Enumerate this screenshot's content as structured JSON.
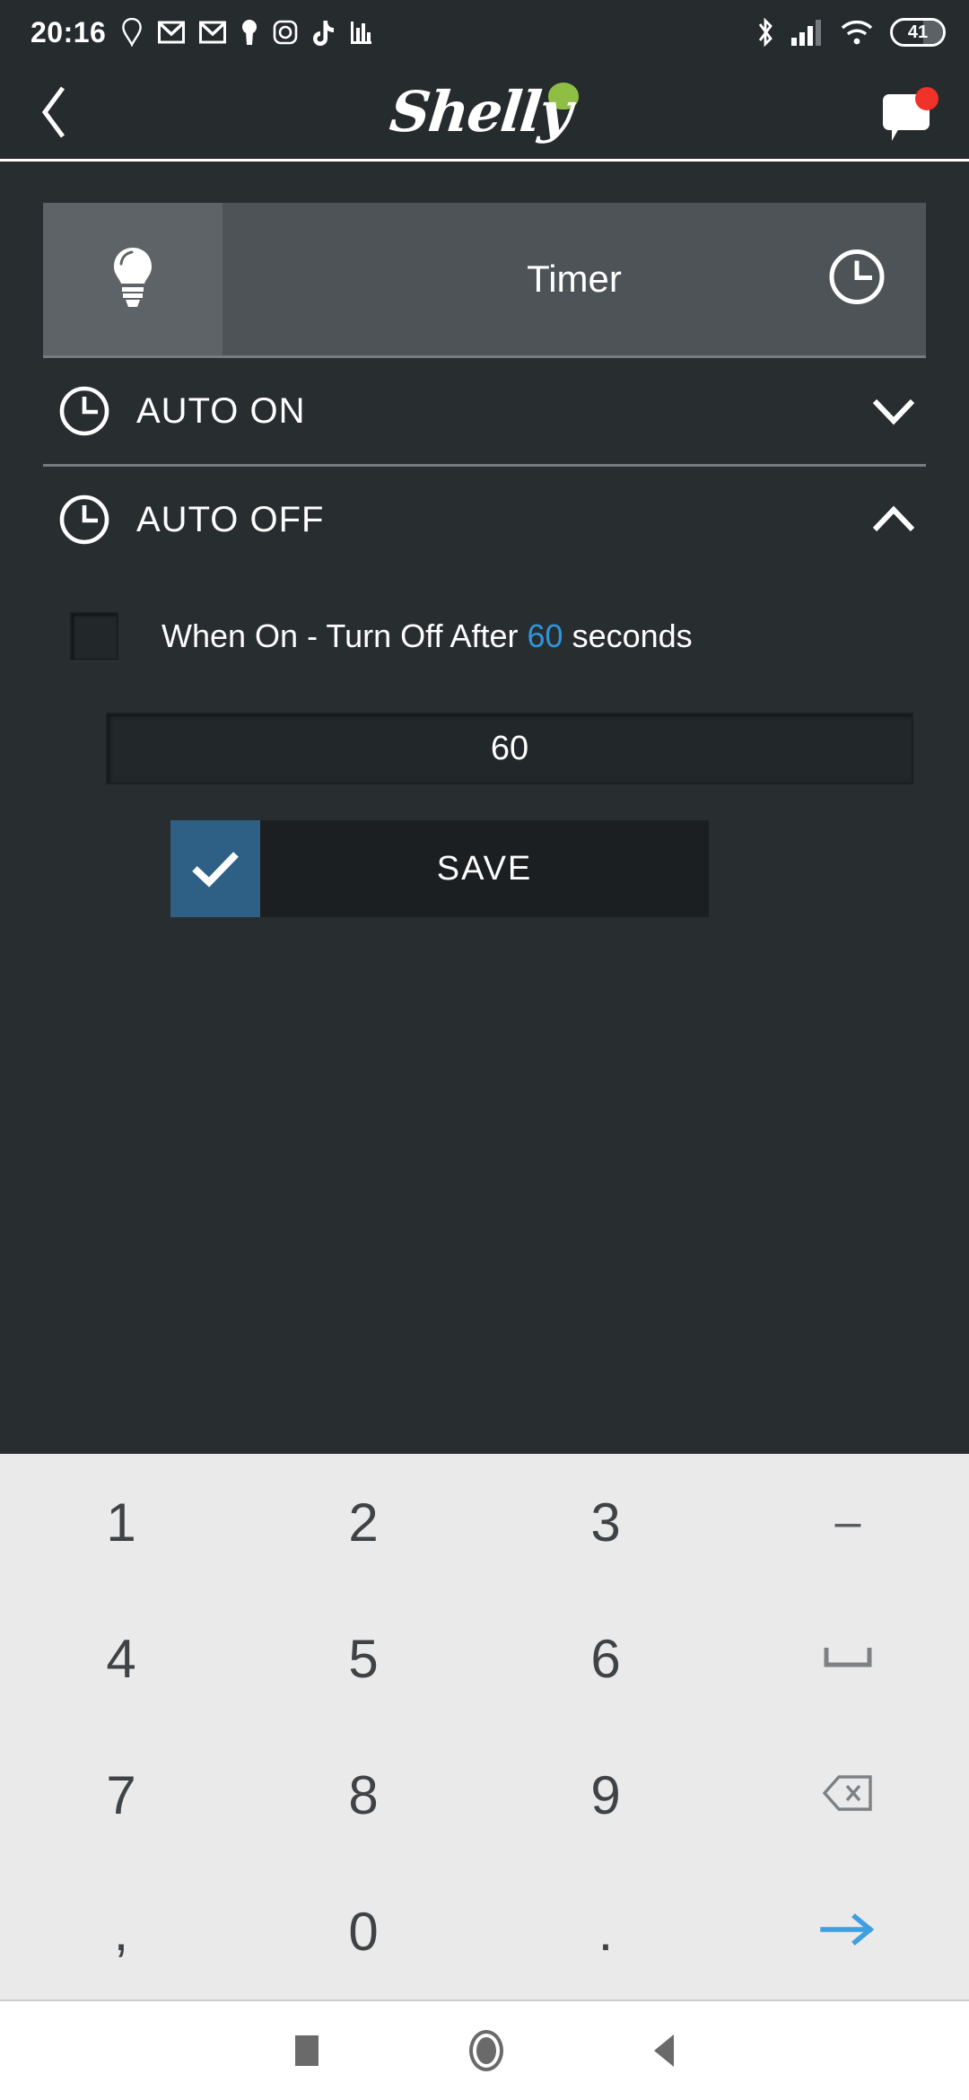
{
  "status_bar": {
    "time": "20:16",
    "left_icons": [
      "location-icon",
      "gmail-icon",
      "gmail-icon",
      "keyhole-icon",
      "instagram-icon",
      "tiktok-icon",
      "bar-chart-icon"
    ],
    "right_icons": [
      "bluetooth-icon",
      "cellular-signal-icon",
      "wifi-icon"
    ],
    "battery_level": "41"
  },
  "app_bar": {
    "back_label": "Back",
    "brand": "Shelly",
    "chat_icon": "chat-bubble-icon",
    "has_notification": true
  },
  "timer_bar": {
    "bulb_icon": "lightbulb-icon",
    "title": "Timer",
    "clock_icon": "clock-icon"
  },
  "rows": [
    {
      "label": "AUTO ON",
      "icon": "clock-icon",
      "chevron": "chevron-down-icon",
      "expanded": false
    },
    {
      "label": "AUTO OFF",
      "icon": "clock-icon",
      "chevron": "chevron-up-icon",
      "expanded": true
    }
  ],
  "auto_off_panel": {
    "checkbox_checked": false,
    "text_before": "When On - Turn Off After",
    "highlight_value": "60",
    "text_after": "seconds",
    "input_value": "60",
    "input_placeholder": "60",
    "save_label": "SAVE",
    "save_check_icon": "check-icon"
  },
  "keyboard": {
    "keys": [
      {
        "label": "1",
        "name": "key-1",
        "type": "num"
      },
      {
        "label": "2",
        "name": "key-2",
        "type": "num"
      },
      {
        "label": "3",
        "name": "key-3",
        "type": "num"
      },
      {
        "label": "–",
        "name": "key-minus",
        "type": "sym"
      },
      {
        "label": "4",
        "name": "key-4",
        "type": "num"
      },
      {
        "label": "5",
        "name": "key-5",
        "type": "num"
      },
      {
        "label": "6",
        "name": "key-6",
        "type": "num"
      },
      {
        "label": "␣",
        "name": "key-space",
        "type": "sym"
      },
      {
        "label": "7",
        "name": "key-7",
        "type": "num"
      },
      {
        "label": "8",
        "name": "key-8",
        "type": "num"
      },
      {
        "label": "9",
        "name": "key-9",
        "type": "num"
      },
      {
        "label": "⌫",
        "name": "key-backspace",
        "type": "sym"
      },
      {
        "label": ",",
        "name": "key-comma",
        "type": "num"
      },
      {
        "label": "0",
        "name": "key-0",
        "type": "num"
      },
      {
        "label": ".",
        "name": "key-period",
        "type": "num"
      },
      {
        "label": "→",
        "name": "key-enter",
        "type": "enter"
      }
    ]
  },
  "nav_bar": {
    "recents": "recents-square-icon",
    "home": "home-circle-icon",
    "back": "back-triangle-icon"
  },
  "colors": {
    "background": "#282d30",
    "app_bar": "#262b2e",
    "timer_bar": "#4d5356",
    "timer_bulb_panel": "#5d6366",
    "accent_blue": "#2f95d8",
    "save_blue": "#2e5f85",
    "brand_green": "#8fbe45",
    "notification_red": "#f03229",
    "keyboard_bg": "#eaeaea",
    "enter_blue": "#3f9fe0"
  }
}
